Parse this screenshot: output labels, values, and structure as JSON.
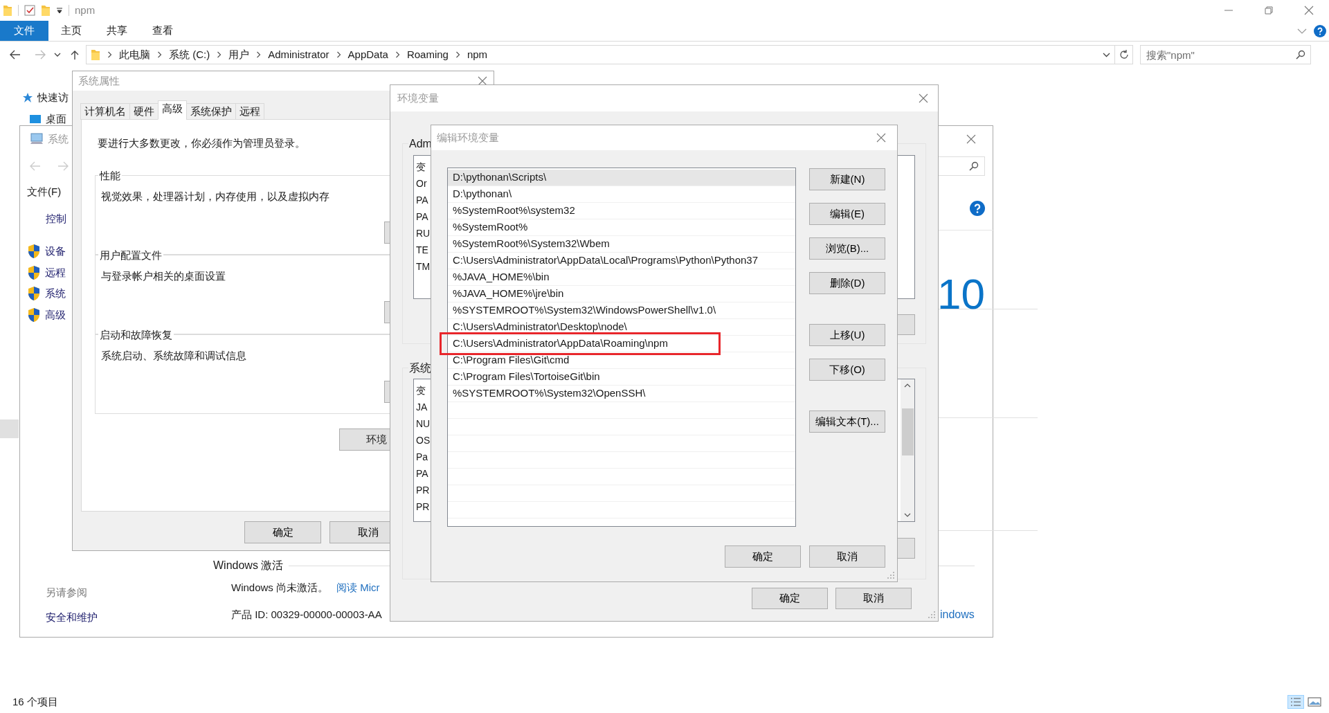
{
  "explorer": {
    "title": "npm",
    "ribbon_tabs": [
      {
        "label": "文件",
        "selected": true
      },
      {
        "label": "主页",
        "selected": false
      },
      {
        "label": "共享",
        "selected": false
      },
      {
        "label": "查看",
        "selected": false
      }
    ],
    "breadcrumb": [
      "此电脑",
      "系统 (C:)",
      "用户",
      "Administrator",
      "AppData",
      "Roaming",
      "npm"
    ],
    "search": {
      "placeholder": "搜索\"npm\""
    },
    "nav_items": [
      "快速访",
      "桌面"
    ],
    "status_bar": "16 个项目"
  },
  "system_window": {
    "title": "系统",
    "menu": "文件(F)",
    "home_link": "控制",
    "tasks": [
      "设备",
      "远程",
      "系统",
      "高级"
    ],
    "see_also": "另请参阅",
    "see_also_link": "安全和维护",
    "edition_fragment": "10",
    "activation_heading": "Windows 激活",
    "activation_status": "Windows 尚未激活。",
    "activation_link": "阅读 Micr",
    "product_id": "产品 ID: 00329-00000-00003-AA",
    "link_fragment": "indows"
  },
  "system_properties": {
    "title": "系统属性",
    "tabs": [
      {
        "label": "计算机名",
        "selected": false
      },
      {
        "label": "硬件",
        "selected": false
      },
      {
        "label": "高级",
        "selected": true
      },
      {
        "label": "系统保护",
        "selected": false
      },
      {
        "label": "远程",
        "selected": false
      }
    ],
    "notice": "要进行大多数更改，你必须作为管理员登录。",
    "groups": [
      {
        "title": "性能",
        "description": "视觉效果，处理器计划，内存使用，以及虚拟内存"
      },
      {
        "title": "用户配置文件",
        "description": "与登录帐户相关的桌面设置"
      },
      {
        "title": "启动和故障恢复",
        "description": "系统启动、系统故障和调试信息"
      }
    ],
    "env_button": "环境",
    "ok": "确定",
    "cancel": "取消"
  },
  "environment_variables": {
    "title": "环境变量",
    "user_label": "Adm",
    "user_rows": [
      "变",
      "Or",
      "PA",
      "PA",
      "RU",
      "TE",
      "TM"
    ],
    "system_label": "系统",
    "system_rows": [
      "变",
      "JA",
      "NU",
      "OS",
      "Pa",
      "PA",
      "PR",
      "PR"
    ],
    "ok": "确定",
    "cancel": "取消"
  },
  "edit_dialog": {
    "title": "编辑环境变量",
    "entries": [
      {
        "text": "D:\\pythonan\\Scripts\\",
        "selected": true,
        "marked": false
      },
      {
        "text": "D:\\pythonan\\",
        "selected": false,
        "marked": false
      },
      {
        "text": "%SystemRoot%\\system32",
        "selected": false,
        "marked": false
      },
      {
        "text": "%SystemRoot%",
        "selected": false,
        "marked": false
      },
      {
        "text": "%SystemRoot%\\System32\\Wbem",
        "selected": false,
        "marked": false
      },
      {
        "text": "C:\\Users\\Administrator\\AppData\\Local\\Programs\\Python\\Python37",
        "selected": false,
        "marked": false
      },
      {
        "text": "%JAVA_HOME%\\bin",
        "selected": false,
        "marked": false
      },
      {
        "text": "%JAVA_HOME%\\jre\\bin",
        "selected": false,
        "marked": false
      },
      {
        "text": "%SYSTEMROOT%\\System32\\WindowsPowerShell\\v1.0\\",
        "selected": false,
        "marked": false
      },
      {
        "text": "C:\\Users\\Administrator\\Desktop\\node\\",
        "selected": false,
        "marked": false
      },
      {
        "text": "C:\\Users\\Administrator\\AppData\\Roaming\\npm",
        "selected": false,
        "marked": true
      },
      {
        "text": "C:\\Program Files\\Git\\cmd",
        "selected": false,
        "marked": false
      },
      {
        "text": "C:\\Program Files\\TortoiseGit\\bin",
        "selected": false,
        "marked": false
      },
      {
        "text": "%SYSTEMROOT%\\System32\\OpenSSH\\",
        "selected": false,
        "marked": false
      }
    ],
    "button_groups": [
      [
        "新建(N)",
        "编辑(E)",
        "浏览(B)...",
        "删除(D)"
      ],
      [
        "上移(U)",
        "下移(O)"
      ],
      [
        "编辑文本(T)..."
      ]
    ],
    "ok": "确定",
    "cancel": "取消"
  }
}
